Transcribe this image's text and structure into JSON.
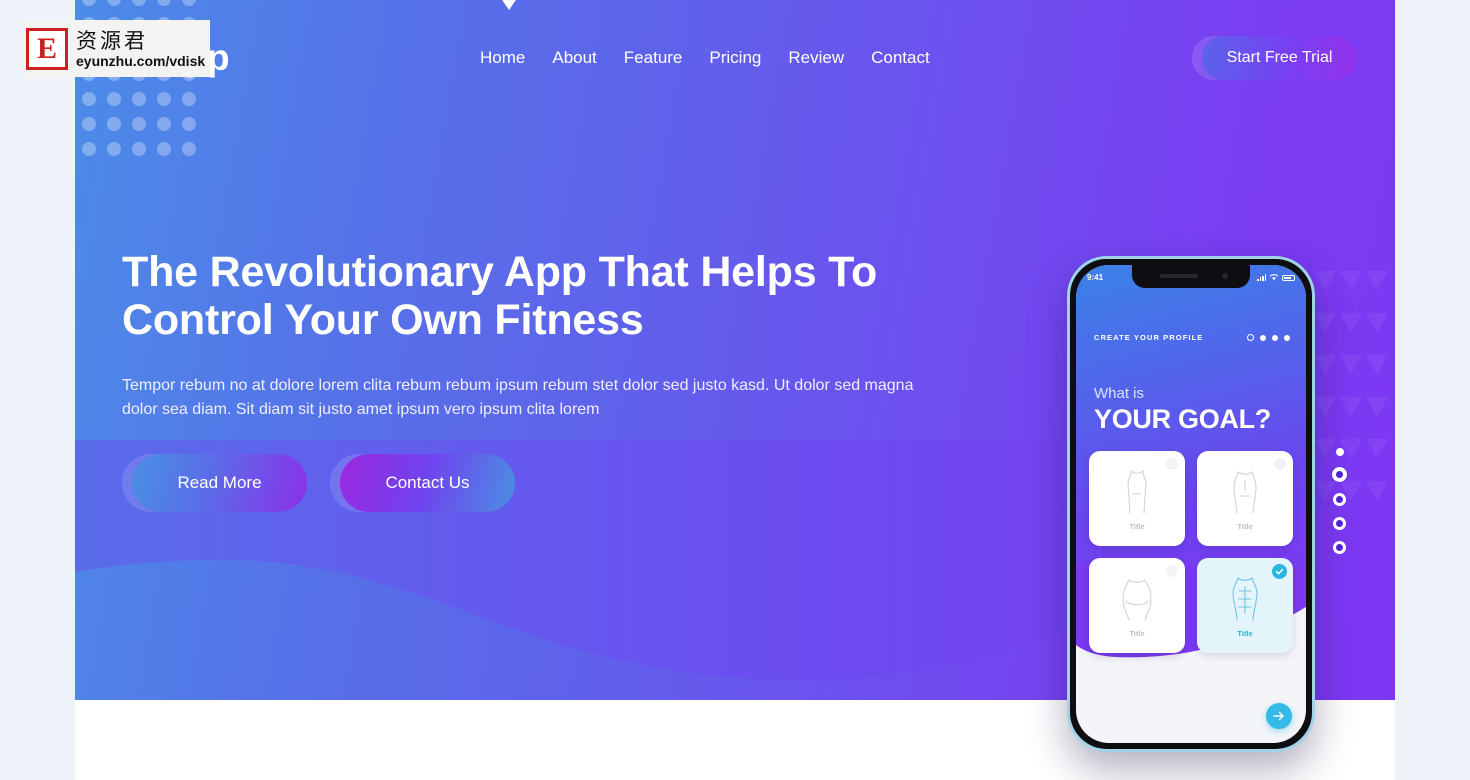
{
  "page": {
    "background_color": "#eef3fa",
    "container_background": "#ffffff"
  },
  "theme": {
    "gradient_start": "#4c8ce8",
    "gradient_end": "#7d37f3",
    "accent_cyan": "#34b9e8",
    "accent_purple": "#4f22d6",
    "text_on_hero": "#ffffff"
  },
  "navbar": {
    "brand": "FitApp",
    "links": [
      {
        "label": "Home"
      },
      {
        "label": "About"
      },
      {
        "label": "Feature"
      },
      {
        "label": "Pricing"
      },
      {
        "label": "Review"
      },
      {
        "label": "Contact"
      }
    ],
    "cta_label": "Start Free Trial"
  },
  "hero": {
    "title": "The Revolutionary App That Helps To Control Your Own Fitness",
    "paragraph": "Tempor rebum no at dolore lorem clita rebum rebum ipsum rebum stet dolor sed justo kasd. Ut dolor sed magna dolor sea diam. Sit diam sit justo amet ipsum vero ipsum clita lorem",
    "primary_button": "Read More",
    "secondary_button": "Contact Us"
  },
  "pagination": {
    "total": 5,
    "active_index": 1
  },
  "phone": {
    "status_time": "9:41",
    "header_label": "CREATE YOUR PROFILE",
    "step_total": 4,
    "step_active_index": 0,
    "question_small": "What is",
    "question_large": "YOUR GOAL?",
    "cards": [
      {
        "title": "Title",
        "selected": false
      },
      {
        "title": "Title",
        "selected": false
      },
      {
        "title": "Title",
        "selected": false
      },
      {
        "title": "Title",
        "selected": true
      }
    ],
    "next_icon": "arrow-right-icon"
  },
  "watermark": {
    "mark": "E",
    "chinese": "资源君",
    "url": "eyunzhu.com/vdisk"
  }
}
